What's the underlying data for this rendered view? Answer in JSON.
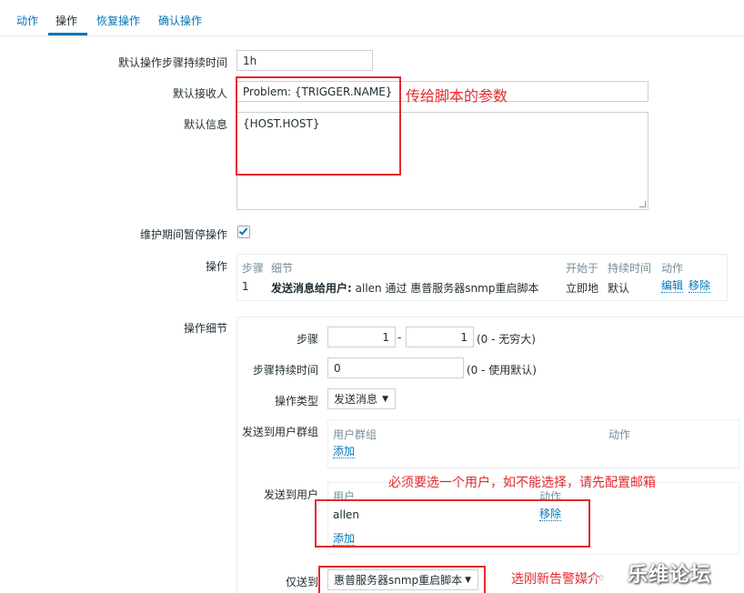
{
  "tabs": [
    "动作",
    "操作",
    "恢复操作",
    "确认操作"
  ],
  "form": {
    "step_duration_label": "默认操作步骤持续时间",
    "step_duration_value": "1h",
    "default_subject_label": "默认接收人",
    "default_subject_value": "Problem: {TRIGGER.NAME}",
    "default_message_label": "默认信息",
    "default_message_value": "{HOST.HOST}",
    "pause_label": "维护期间暂停操作",
    "pause_checked": true,
    "operations_label": "操作"
  },
  "operations_table": {
    "headers": [
      "步骤",
      "细节",
      "开始于",
      "持续时间",
      "动作"
    ],
    "row": {
      "step": "1",
      "detail_bold": "发送消息给用户:",
      "detail_rest": "allen 通过 惠普服务器snmp重启脚本",
      "start": "立即地",
      "duration": "默认",
      "edit": "编辑",
      "remove": "移除"
    }
  },
  "details": {
    "label": "操作细节",
    "steps_label": "步骤",
    "step_from": "1",
    "step_separator": "-",
    "step_to": "1",
    "step_hint": "(0 - 无穷大)",
    "step_duration_label": "步骤持续时间",
    "step_duration_value": "0",
    "step_duration_hint": "(0 - 使用默认)",
    "op_type_label": "操作类型",
    "op_type_value": "发送消息",
    "send_group_label": "发送到用户群组",
    "group_headers": [
      "用户群组",
      "动作"
    ],
    "group_add": "添加",
    "send_user_label": "发送到用户",
    "user_headers": [
      "用户",
      "动作"
    ],
    "user_name": "allen",
    "user_remove": "移除",
    "user_add": "添加",
    "only_to_label": "仅送到",
    "only_to_value": "惠普服务器snmp重启脚本"
  },
  "annotations": {
    "params": "传给脚本的参数",
    "user_note": "必须要选一个用户，如不能选择，请先配置邮箱",
    "media_note": "选刚新告警媒介"
  },
  "watermark": "乐维论坛",
  "watermark_dim": "n.ne",
  "colors": {
    "link": "#0275b8",
    "annotation": "#e5292d",
    "label_muted": "#768d99"
  }
}
